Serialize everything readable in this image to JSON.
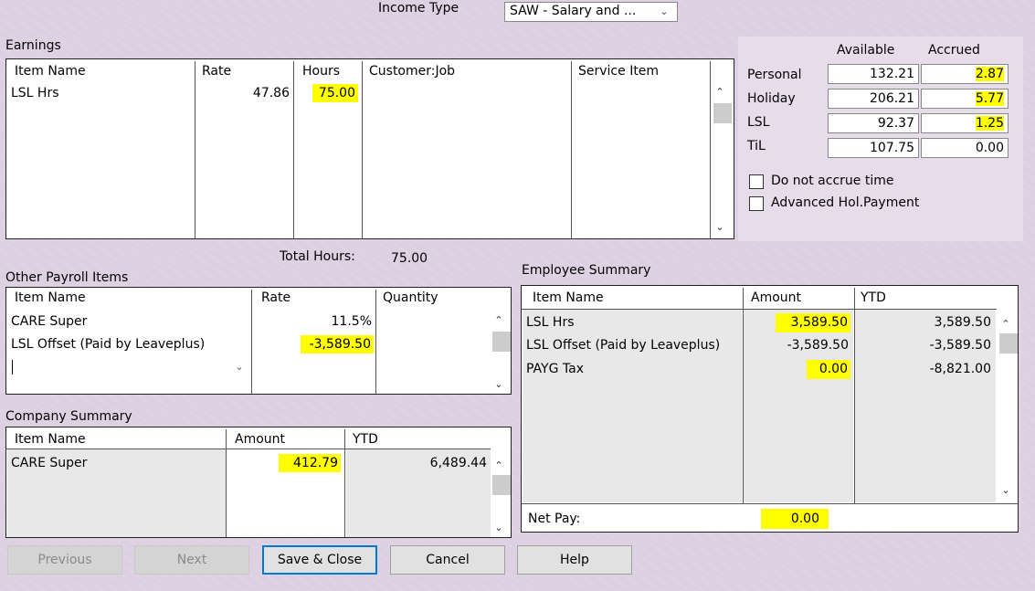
{
  "income_type": {
    "label": "Income Type",
    "value": "SAW - Salary and ..."
  },
  "earnings": {
    "title": "Earnings",
    "columns": [
      "Item Name",
      "Rate",
      "Hours",
      "Customer:Job",
      "Service Item"
    ],
    "rows": [
      {
        "item": "LSL Hrs",
        "rate": "47.86",
        "hours": "75.00",
        "customer_job": "",
        "service_item": ""
      }
    ],
    "total_hours_label": "Total Hours:",
    "total_hours_value": "75.00"
  },
  "leave": {
    "col_available": "Available",
    "col_accrued": "Accrued",
    "rows": [
      {
        "name": "Personal",
        "available": "132.21",
        "accrued": "2.87"
      },
      {
        "name": "Holiday",
        "available": "206.21",
        "accrued": "5.77"
      },
      {
        "name": "LSL",
        "available": "92.37",
        "accrued": "1.25"
      },
      {
        "name": "TiL",
        "available": "107.75",
        "accrued": "0.00"
      }
    ],
    "do_not_accrue_label": "Do not accrue time",
    "advanced_hol_label": "Advanced Hol.Payment"
  },
  "other_payroll": {
    "title": "Other Payroll Items",
    "columns": [
      "Item Name",
      "Rate",
      "Quantity"
    ],
    "rows": [
      {
        "item": "CARE Super",
        "rate": "11.5%",
        "quantity": ""
      },
      {
        "item": "LSL Offset (Paid by Leaveplus)",
        "rate": "-3,589.50",
        "quantity": ""
      }
    ]
  },
  "company_summary": {
    "title": "Company Summary",
    "columns": [
      "Item Name",
      "Amount",
      "YTD"
    ],
    "rows": [
      {
        "item": "CARE Super",
        "amount": "412.79",
        "ytd": "6,489.44"
      }
    ]
  },
  "employee_summary": {
    "title": "Employee Summary",
    "columns": [
      "Item Name",
      "Amount",
      "YTD"
    ],
    "rows": [
      {
        "item": "LSL Hrs",
        "amount": "3,589.50",
        "ytd": "3,589.50"
      },
      {
        "item": "LSL Offset (Paid by Leaveplus)",
        "amount": "-3,589.50",
        "ytd": "-3,589.50"
      },
      {
        "item": "PAYG Tax",
        "amount": "0.00",
        "ytd": "-8,821.00"
      }
    ],
    "net_pay_label": "Net Pay:",
    "net_pay_value": "0.00"
  },
  "buttons": {
    "previous": "Previous",
    "next": "Next",
    "save_close": "Save & Close",
    "cancel": "Cancel",
    "help": "Help"
  },
  "colors": {
    "highlight": "#ffff00",
    "background": "#ddd0e2",
    "focus": "#0078d7"
  }
}
